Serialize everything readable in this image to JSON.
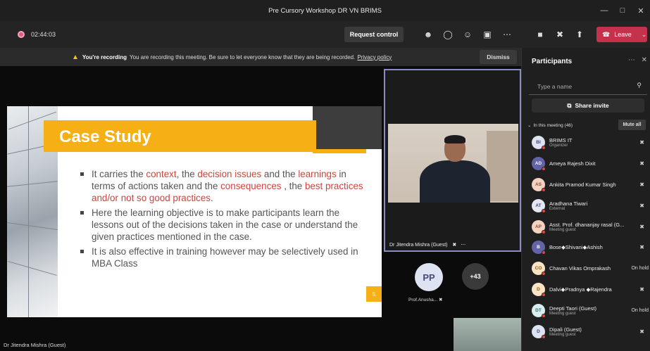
{
  "window": {
    "title": "Pre Cursory Workshop DR VN BRIMS"
  },
  "toolbar": {
    "timer": "02:44:03",
    "request_control": "Request control",
    "leave": "Leave"
  },
  "banner": {
    "bold": "You're recording",
    "message": "You are recording this meeting. Be sure to let everyone know that they are being recorded.",
    "link": "Privacy policy",
    "dismiss": "Dismiss"
  },
  "slide": {
    "title": "Case Study",
    "page": "5",
    "bullet1": {
      "p1": "It carries the ",
      "r1": "context",
      "p2": ", the ",
      "r2": "decision issues",
      "p3": " and the ",
      "r3": "learnings",
      "p4": " in terms of actions taken and the ",
      "r4": "consequences",
      "p5": " , the ",
      "r5": "best practices and/or not so good practices",
      "p6": "."
    },
    "bullet2": "Here the learning objective is to make participants learn the lessons out of the decisions taken in the case or understand the given practices mentioned in the case.",
    "bullet3": "It is also effective in training however may be selectively used in MBA Class"
  },
  "presenter_label": "Dr Jitendra Mishra (Guest)",
  "video": {
    "label": "Dr Jitendra Mishra (Guest)"
  },
  "tiles": {
    "pp_initials": "PP",
    "pp_label": "Prof.Anusha...",
    "more": "+43"
  },
  "panel": {
    "title": "Participants",
    "search_placeholder": "Type a name",
    "share_invite": "Share invite",
    "section": "In this meeting (46)",
    "mute_all": "Mute all",
    "participants": [
      {
        "initials": "BI",
        "name": "BRIMS IT",
        "role": "Organizer",
        "bg": "#dde3f0",
        "fg": "#444a7a",
        "status": "mic-off"
      },
      {
        "initials": "AD",
        "name": "Ameya Rajesh Dixit",
        "role": "",
        "bg": "#6264a7",
        "fg": "#ffffff",
        "status": "mic-off"
      },
      {
        "initials": "AS",
        "name": "Ankita Pramod Kumar Singh",
        "role": "",
        "bg": "#f3d2c1",
        "fg": "#a0462a",
        "status": "mic-off"
      },
      {
        "initials": "AT",
        "name": "Aradhana Tiwari",
        "role": "External",
        "bg": "#e5e8f3",
        "fg": "#444a7a",
        "status": "mic-off"
      },
      {
        "initials": "AP",
        "name": "Asst. Prof. dhananjay rasal (G...",
        "role": "Meeting guest",
        "bg": "#f3d2c1",
        "fg": "#a0462a",
        "status": "mic-off"
      },
      {
        "initials": "B",
        "name": "Bose◆Shivani◆Ashish",
        "role": "",
        "bg": "#6264a7",
        "fg": "#ffffff",
        "status": "mic-off"
      },
      {
        "initials": "CO",
        "name": "Chavan Vikas Omprakash",
        "role": "",
        "bg": "#fbe3c4",
        "fg": "#8a5a10",
        "status": "On hold"
      },
      {
        "initials": "D",
        "name": "Dalvi◆Pradnya ◆Rajendra",
        "role": "",
        "bg": "#fbe3c4",
        "fg": "#8a5a10",
        "status": "mic-off"
      },
      {
        "initials": "DT",
        "name": "Deepti Taori (Guest)",
        "role": "Meeting guest",
        "bg": "#d9efef",
        "fg": "#2a6f6f",
        "status": "On hold"
      },
      {
        "initials": "D",
        "name": "Dipali (Guest)",
        "role": "Meeting guest",
        "bg": "#dde3f0",
        "fg": "#444a7a",
        "status": "mic-off"
      }
    ]
  },
  "colors": {
    "accent": "#6264a7",
    "leave": "#c4314b",
    "slide_orange": "#f6b015",
    "slide_red": "#d0423b"
  }
}
